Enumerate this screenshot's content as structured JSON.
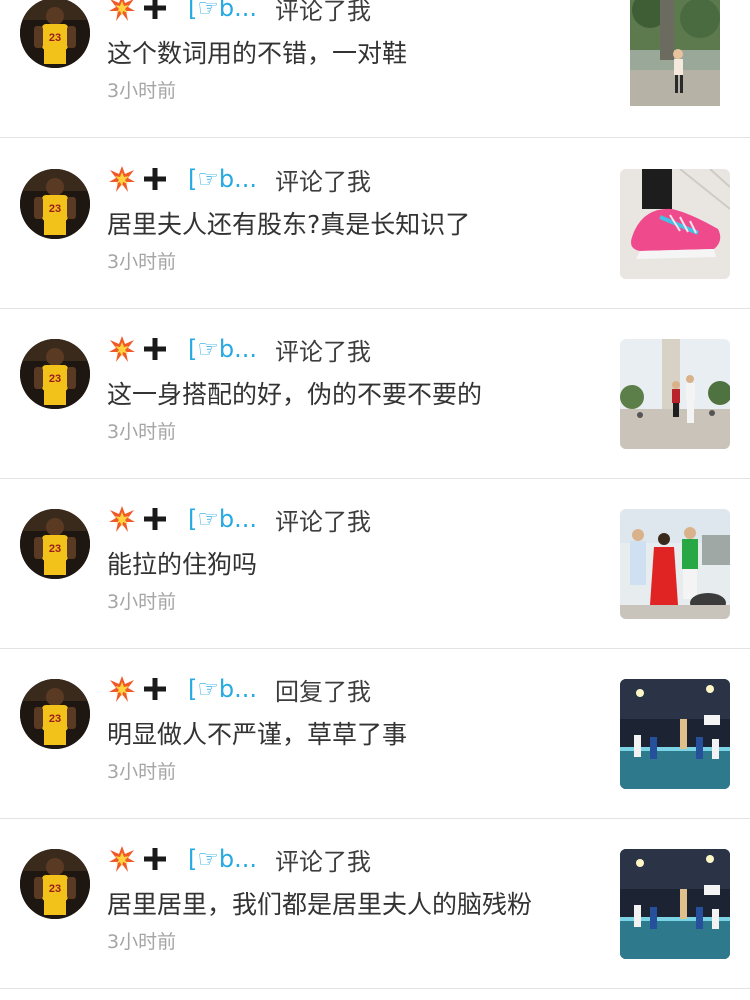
{
  "feed": [
    {
      "username": "[☞b...",
      "action": "评论了我",
      "comment": "这个数词用的不错，一对鞋",
      "time": "3小时前",
      "thumb": "photo-woman-statue"
    },
    {
      "username": "[☞b...",
      "action": "评论了我",
      "comment": "居里夫人还有股东?真是长知识了",
      "time": "3小时前",
      "thumb": "photo-pink-sneaker"
    },
    {
      "username": "[☞b...",
      "action": "评论了我",
      "comment": "这一身搭配的好，伪的不要不要的",
      "time": "3小时前",
      "thumb": "photo-couple-plaza"
    },
    {
      "username": "[☞b...",
      "action": "评论了我",
      "comment": "能拉的住狗吗",
      "time": "3小时前",
      "thumb": "photo-group-dog"
    },
    {
      "username": "[☞b...",
      "action": "回复了我",
      "comment": "明显做人不严谨，草草了事",
      "time": "3小时前",
      "thumb": "photo-basketball-court"
    },
    {
      "username": "[☞b...",
      "action": "评论了我",
      "comment": "居里居里，我们都是居里夫人的脑残粉",
      "time": "3小时前",
      "thumb": "photo-basketball-court"
    }
  ],
  "icons": {
    "avatar": "player-23-avatar",
    "burst": "collision-burst-icon",
    "plus": "plus-icon"
  },
  "colors": {
    "username": "#27a9e1",
    "text": "#333333",
    "time": "#a5a5a5",
    "divider": "#e3e3e3"
  }
}
